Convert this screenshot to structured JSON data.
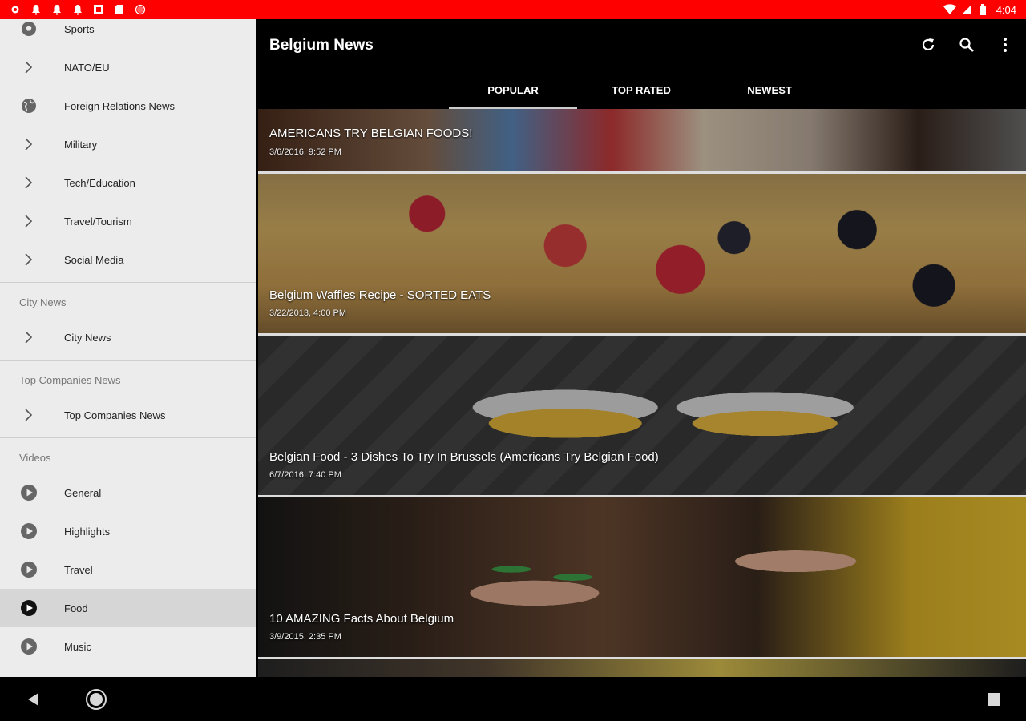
{
  "status_bar": {
    "time": "4:04",
    "left_icons": [
      "settings-icon",
      "notification-icon",
      "notification-icon",
      "notification-icon",
      "photo-icon",
      "sd-card-icon",
      "record-icon"
    ],
    "right_icons": [
      "wifi-icon",
      "signal-icon",
      "battery-icon"
    ],
    "color": "#ff0000"
  },
  "drawer": {
    "top_items": [
      {
        "label": "Sports",
        "icon": "soccer-ball-icon"
      },
      {
        "label": "NATO/EU",
        "icon": "chevron-right-icon"
      },
      {
        "label": "Foreign Relations News",
        "icon": "globe-icon"
      },
      {
        "label": "Military",
        "icon": "chevron-right-icon"
      },
      {
        "label": "Tech/Education",
        "icon": "chevron-right-icon"
      },
      {
        "label": "Travel/Tourism",
        "icon": "chevron-right-icon"
      },
      {
        "label": "Social Media",
        "icon": "chevron-right-icon"
      }
    ],
    "sections": {
      "city": {
        "header": "City News",
        "item": "City News"
      },
      "companies": {
        "header": "Top Companies News",
        "item": "Top Companies News"
      },
      "videos": {
        "header": "Videos",
        "items": [
          "General",
          "Highlights",
          "Travel",
          "Food",
          "Music"
        ],
        "selected": "Food"
      }
    }
  },
  "appbar": {
    "title": "Belgium News",
    "actions": [
      "refresh-icon",
      "search-icon",
      "more-vert-icon"
    ],
    "tabs": [
      "POPULAR",
      "TOP RATED",
      "NEWEST"
    ],
    "active_tab": "POPULAR"
  },
  "feed": [
    {
      "title": "AMERICANS TRY BELGIAN FOODS!",
      "date": "3/6/2016, 9:52 PM"
    },
    {
      "title": "Belgium Waffles Recipe - SORTED EATS",
      "date": "3/22/2013, 4:00 PM"
    },
    {
      "title": "Belgian Food - 3 Dishes To Try In Brussels (Americans Try Belgian Food)",
      "date": "6/7/2016, 7:40 PM"
    },
    {
      "title": "10 AMAZING Facts About Belgium",
      "date": "3/9/2015, 2:35 PM"
    }
  ],
  "navigation": [
    "back-icon",
    "home-icon",
    "recents-icon"
  ]
}
